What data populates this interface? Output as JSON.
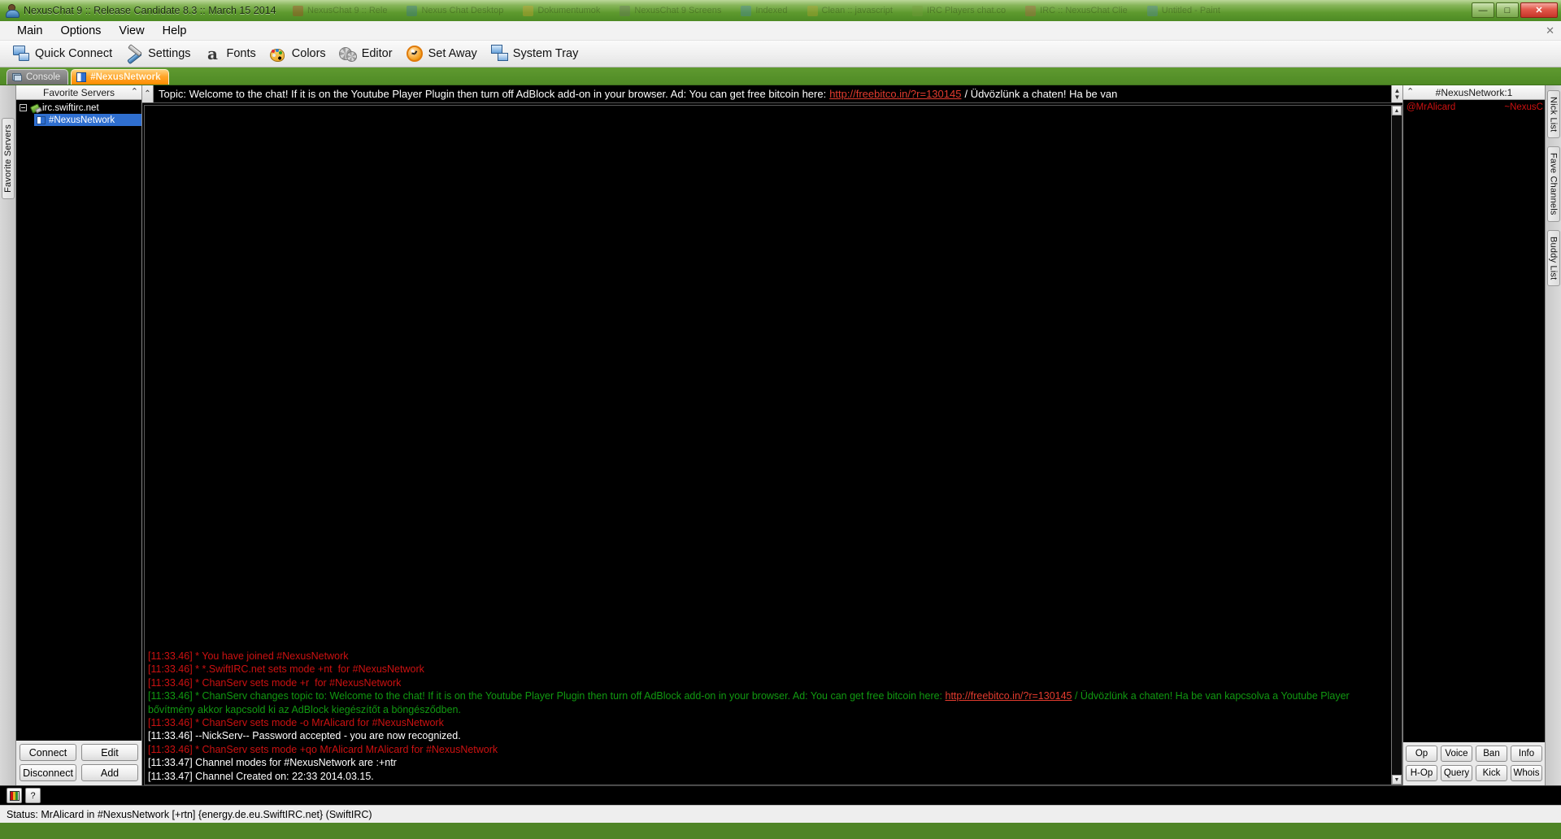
{
  "window": {
    "title": "NexusChat 9 :: Release Candidate 8.3 :: March 15 2014",
    "title_icon": "app-icon",
    "minimize_label": "—",
    "maximize_label": "□",
    "close_label": "✕",
    "ghost_items": [
      {
        "label": "NexusChat 9 :: Rele",
        "color": "#b5321f"
      },
      {
        "label": "Nexus Chat Desktop",
        "color": "#2f6ea8"
      },
      {
        "label": "Dokumentumok",
        "color": "#e0a32c"
      },
      {
        "label": "NexusChat 9 Screens",
        "color": "#6a6a6a"
      },
      {
        "label": "Indexed",
        "color": "#3f7fbf"
      },
      {
        "label": "Clean :: javascript",
        "color": "#c4a32c"
      },
      {
        "label": "IRC Players chat.co",
        "color": "#7a9a3f"
      },
      {
        "label": "IRC :: NexusChat Clie",
        "color": "#c0564a"
      },
      {
        "label": "Untitled - Paint",
        "color": "#4a7fbf"
      }
    ]
  },
  "menu": {
    "items": [
      "Main",
      "Options",
      "View",
      "Help"
    ],
    "close_x": "✕"
  },
  "toolbar": {
    "buttons": [
      {
        "label": "Quick Connect",
        "icon": "monitor-icon"
      },
      {
        "label": "Settings",
        "icon": "tools-icon"
      },
      {
        "label": "Fonts",
        "icon": "font-a-icon"
      },
      {
        "label": "Colors",
        "icon": "palette-icon"
      },
      {
        "label": "Editor",
        "icon": "gears-icon"
      },
      {
        "label": "Set Away",
        "icon": "clock-icon"
      },
      {
        "label": "System Tray",
        "icon": "tray-icon"
      }
    ]
  },
  "tabs": [
    {
      "label": "Console",
      "icon": "console-icon",
      "active": false
    },
    {
      "label": "#NexusNetwork",
      "icon": "channel-icon",
      "active": true
    }
  ],
  "left_vertical_tab": {
    "label": "Favorite Servers"
  },
  "favorites": {
    "header": "Favorite Servers",
    "collapse_icon": "chevron-up-icon",
    "tree": [
      {
        "label": "irc.swiftirc.net",
        "type": "server",
        "icon": "plug-icon",
        "expanded": true,
        "selected": false
      },
      {
        "label": "#NexusNetwork",
        "type": "channel",
        "icon": "channel-icon",
        "expanded": false,
        "selected": true
      }
    ],
    "buttons": [
      "Connect",
      "Edit",
      "Disconnect",
      "Add"
    ]
  },
  "topic": {
    "collapse_icon": "chevron-up-icon",
    "prefix": "Topic: Welcome to the chat! If it is on the Youtube Player Plugin then turn off AdBlock add-on in your browser. Ad: You can get free bitcoin here:",
    "link": "http://freebitco.in/?r=130145",
    "suffix": "/ Üdvözlünk a chaten! Ha be van"
  },
  "chat": {
    "lines": [
      {
        "time": "[11:33.46]",
        "text": " * You have joined #NexusNetwork",
        "color": "red"
      },
      {
        "time": "[11:33.46]",
        "text": " * *.SwiftIRC.net sets mode +nt  for #NexusNetwork",
        "color": "red"
      },
      {
        "time": "[11:33.46]",
        "text": " * ChanServ sets mode +r  for #NexusNetwork",
        "color": "red"
      },
      {
        "time": "[11:33.46]",
        "text": " * ChanServ changes topic to: Welcome to the chat! If it is on the Youtube Player Plugin then turn off AdBlock add-on in your browser. Ad: You can get free bitcoin here: ",
        "color": "green",
        "link": "http://freebitco.in/?r=130145",
        "text_after": " / Üdvözlünk a chaten! Ha be van kapcsolva a Youtube Player bővítmény akkor kapcsold ki az AdBlock kiegészítőt a böngésződben."
      },
      {
        "time": "[11:33.46]",
        "text": " * ChanServ sets mode -o MrAlicard for #NexusNetwork",
        "color": "red"
      },
      {
        "time": "[11:33.46]",
        "text": " --NickServ-- Password accepted - you are now recognized.",
        "color": "white"
      },
      {
        "time": "[11:33.46]",
        "text": " * ChanServ sets mode +qo MrAlicard MrAlicard for #NexusNetwork",
        "color": "red"
      },
      {
        "time": "[11:33.47]",
        "text": " Channel modes for #NexusNetwork are :+ntr",
        "color": "white"
      },
      {
        "time": "[11:33.47]",
        "text": " Channel Created on: 22:33 2014.03.15.",
        "color": "white"
      }
    ],
    "scroll_up_icon": "▲",
    "scroll_down_icon": "▼"
  },
  "nicklist": {
    "header": "#NexusNetwork:1",
    "collapse_icon": "chevron-up-icon",
    "nicks": [
      {
        "name": "@MrAlicard",
        "host": "~NexusC"
      }
    ],
    "buttons": [
      "Op",
      "Voice",
      "Ban",
      "Info",
      "H-Op",
      "Query",
      "Kick",
      "Whois"
    ]
  },
  "right_vertical_tabs": [
    {
      "label": "Nick List"
    },
    {
      "label": "Fave Channels"
    },
    {
      "label": "Buddy List"
    }
  ],
  "bottom": {
    "color_button_icon": "color-swatch-icon",
    "help_button_label": "?",
    "status": "Status: MrAlicard in #NexusNetwork [+rtn] {energy.de.eu.SwiftIRC.net} (SwiftIRC)"
  },
  "colors": {
    "accent_green": "#4e8a24",
    "tab_orange": "#ff8c00",
    "log_red": "#cc1111",
    "log_green": "#119911",
    "link_red": "#e23b2e",
    "selection_blue": "#2f6fd0"
  }
}
